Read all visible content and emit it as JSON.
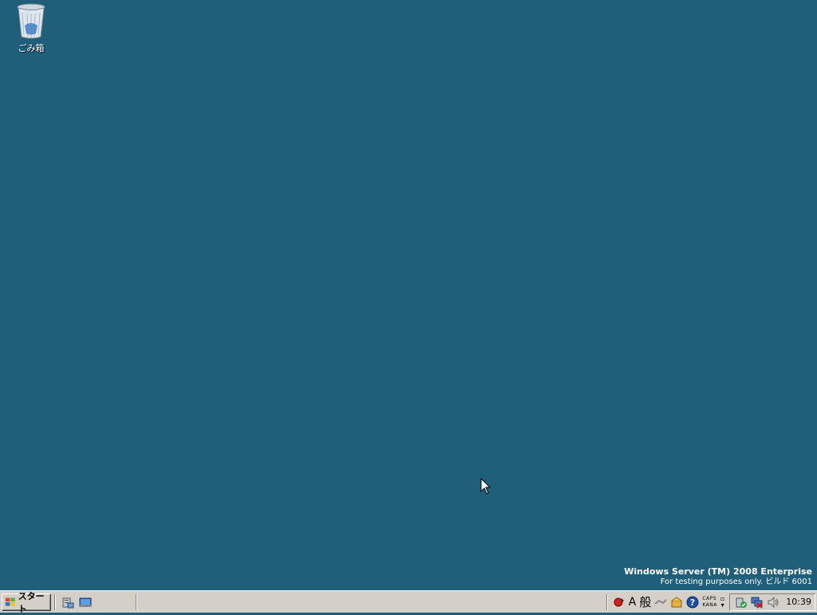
{
  "desktop": {
    "background_color": "#1f5f7a",
    "icons": [
      {
        "label": "ごみ箱",
        "icon": "recycle-bin-icon"
      }
    ]
  },
  "watermark": {
    "line1": "Windows Server (TM) 2008 Enterprise",
    "line2": "For testing purposes only. ビルド 6001"
  },
  "taskbar": {
    "start_label": "スタート",
    "quick_launch": [
      {
        "icon": "server-manager-icon"
      },
      {
        "icon": "show-desktop-icon"
      }
    ],
    "language_bar": {
      "ime_mode": "A",
      "ime_conversion": "般",
      "caps": "CAPS",
      "kana": "KANA"
    },
    "clock": "10:39"
  }
}
